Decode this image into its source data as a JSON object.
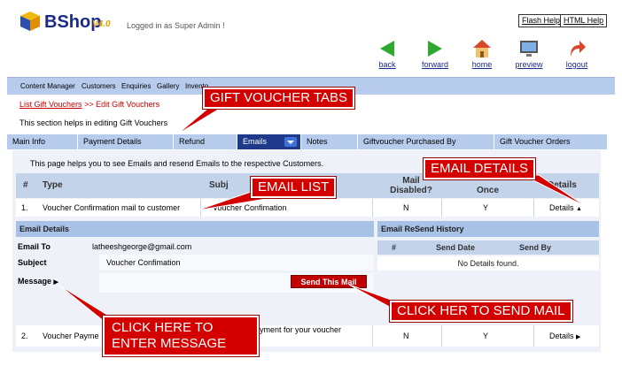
{
  "app": {
    "name": "BShop",
    "version": "V4.0",
    "logged_in_text": "Logged in as Super Admin !",
    "flash_help": "Flash Help",
    "html_help": "HTML Help"
  },
  "nav": {
    "back": "back",
    "forward": "forward",
    "home": "home",
    "preview": "preview",
    "logout": "logout"
  },
  "menu": [
    "Content Manager",
    "Customers",
    "Enquiries",
    "Gallery",
    "Invento"
  ],
  "breadcrumb": {
    "list": "List Gift Vouchers",
    "sep": ">>",
    "current": "Edit Gift Vouchers"
  },
  "section_help": "This section helps in editing Gift Vouchers",
  "tabs": [
    "Main Info",
    "Payment Details",
    "Refund",
    "Emails",
    "Notes",
    "Giftvoucher Purchased By",
    "Gift Voucher Orders"
  ],
  "panel_info": "This page helps you to see Emails and resend Emails to the respective Customers.",
  "email_table": {
    "headers": {
      "num": "#",
      "type": "Type",
      "subject": "Subj",
      "mail_disabled_1": "Mail",
      "mail_disabled_2": "Disabled?",
      "send_once": "Once",
      "details": "Details"
    },
    "rows": [
      {
        "num": "1.",
        "type": "Voucher Confirmation mail to customer",
        "subject": "Voucher Confimation",
        "disabled": "N",
        "once": "Y",
        "details": "Details"
      },
      {
        "num": "2.",
        "type": "Voucher Payme",
        "subject": "ayment for your voucher",
        "disabled": "N",
        "once": "Y",
        "details": "Details"
      }
    ]
  },
  "email_details": {
    "title": "Email Details",
    "email_to_label": "Email To",
    "email_to_value": "latheeshgeorge@gmail.com",
    "subject_label": "Subject",
    "subject_value": "Voucher Confimation",
    "message_label": "Message",
    "send_button": "Send This Mail"
  },
  "resend_history": {
    "title": "Email ReSend History",
    "cols": [
      "#",
      "Send Date",
      "Send By"
    ],
    "empty": "No Details found."
  },
  "callouts": {
    "tabs": "GIFT VOUCHER TABS",
    "email_details": "EMAIL DETAILS",
    "email_list": "EMAIL LIST",
    "message_line1": "CLICK HERE TO",
    "message_line2": "ENTER MESSAGE",
    "send_mail": "CLICK HER TO SEND MAIL"
  },
  "colors": {
    "callout": "#d40000",
    "tab_active": "#1f3a8a",
    "menu_bar": "#b7ccec"
  }
}
